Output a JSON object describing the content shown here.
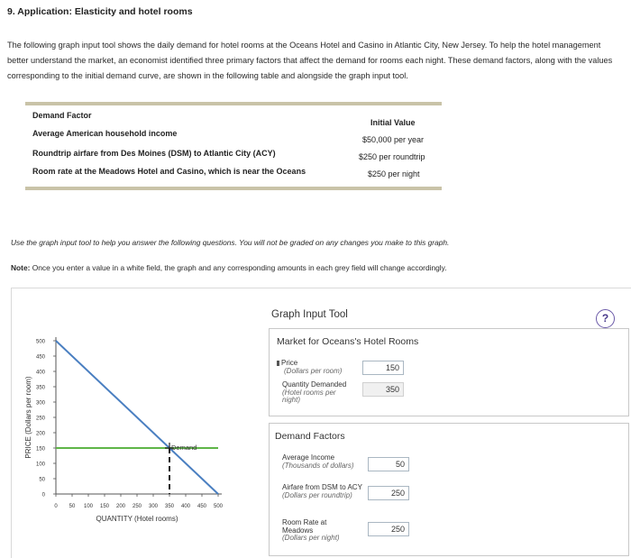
{
  "title": "9. Application: Elasticity and hotel rooms",
  "intro": "The following graph input tool shows the daily demand for hotel rooms at the Oceans Hotel and Casino in Atlantic City, New Jersey. To help the hotel management better understand the market, an economist identified three primary factors that affect the demand for rooms each night. These demand factors, along with the values corresponding to the initial demand curve, are shown in the following table and alongside the graph input tool.",
  "factor_table": {
    "col1_header": "Demand Factor",
    "col2_header": "Initial Value",
    "rows": [
      {
        "factor": "Average American household income",
        "value": "$50,000 per year"
      },
      {
        "factor": "Roundtrip airfare from Des Moines (DSM) to Atlantic City (ACY)",
        "value": "$250 per roundtrip"
      },
      {
        "factor": "Room rate at the Meadows Hotel and Casino, which is near the Oceans",
        "value": "$250 per night"
      }
    ]
  },
  "instructions": "Use the graph input tool to help you answer the following questions. You will not be graded on any changes you make to this graph.",
  "note": {
    "label": "Note:",
    "text": " Once you enter a value in a white field, the graph and any corresponding amounts in each grey field will change accordingly."
  },
  "graph_tool": {
    "title": "Graph Input Tool",
    "help_label": "?",
    "market_title": "Market for Oceans's Hotel Rooms",
    "price_label": "Price",
    "price_unit": "(Dollars per room)",
    "price_value": "150",
    "quantity_label": "Quantity Demanded",
    "quantity_unit": "(Hotel rooms per night)",
    "quantity_value": "350",
    "demand_factors_title": "Demand Factors",
    "income_label": "Average Income",
    "income_unit": "(Thousands of dollars)",
    "income_value": "50",
    "airfare_label": "Airfare from DSM to ACY",
    "airfare_unit": "(Dollars per roundtrip)",
    "airfare_value": "250",
    "roomrate_label": "Room Rate at Meadows",
    "roomrate_unit": "(Dollars per night)",
    "roomrate_value": "250"
  },
  "chart_data": {
    "type": "line",
    "xlabel": "QUANTITY (Hotel rooms)",
    "ylabel": "PRICE (Dollars per room)",
    "xlim": [
      0,
      500
    ],
    "ylim": [
      0,
      500
    ],
    "x_ticks": [
      0,
      50,
      100,
      150,
      200,
      250,
      300,
      350,
      400,
      450,
      500
    ],
    "y_ticks": [
      0,
      50,
      100,
      150,
      200,
      250,
      300,
      350,
      400,
      450,
      500
    ],
    "series": [
      {
        "name": "Demand",
        "color": "#4a7fc1",
        "points": [
          [
            0,
            500
          ],
          [
            500,
            0
          ]
        ]
      }
    ],
    "price_line": {
      "y": 150,
      "color": "#5fb548"
    },
    "selected_point": {
      "x": 350,
      "y": 150
    },
    "grid": false
  }
}
